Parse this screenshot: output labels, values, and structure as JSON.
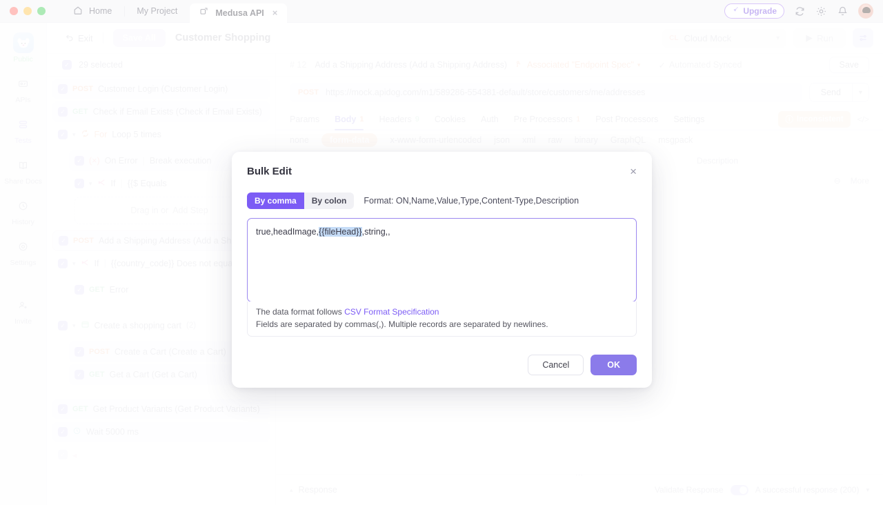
{
  "titlebar": {
    "tabs": [
      {
        "label": "Home",
        "icon": "home-icon",
        "active": false
      },
      {
        "label": "My Project",
        "icon": "",
        "active": false
      },
      {
        "label": "Medusa API",
        "icon": "external-link-icon",
        "active": true,
        "close": "×"
      }
    ],
    "upgrade_label": "Upgrade",
    "icons": [
      "rocket-icon",
      "refresh-icon",
      "gear-icon",
      "bell-icon",
      "avatar"
    ]
  },
  "rail": {
    "items": [
      {
        "label": "Public",
        "icon": "project-avatar-icon"
      },
      {
        "label": "APIs",
        "icon": "apis-icon"
      },
      {
        "label": "Tests",
        "icon": "tests-icon"
      },
      {
        "label": "Share Docs",
        "icon": "share-docs-icon"
      },
      {
        "label": "History",
        "icon": "history-icon"
      },
      {
        "label": "Settings",
        "icon": "settings-icon"
      },
      {
        "label": "Invite",
        "icon": "invite-icon"
      }
    ]
  },
  "toolbar": {
    "exit_label": "Exit",
    "save_all_label": "Save All",
    "doc_title": "Customer Shopping",
    "env_badge": "CL",
    "env_label": "Cloud Mock",
    "run_label": "Run"
  },
  "list_panel": {
    "selected_label": "29 selected",
    "drop_hint_prefix": "Drag in or",
    "drop_hint_action": "Add Step",
    "rows": [
      {
        "method": "POST",
        "label": "Customer Login (Customer Login)",
        "indent": 0,
        "type": "request"
      },
      {
        "method": "GET",
        "label": "Check if Email Exists (Check if Email Exists)",
        "indent": 0,
        "type": "request"
      },
      {
        "method": "",
        "kind": "For",
        "label": "Loop 5 times",
        "indent": 0,
        "type": "loop",
        "icon": "loop-icon"
      },
      {
        "method": "",
        "kind": "On Error",
        "label": "Break execution",
        "indent": 1,
        "type": "onerror",
        "icon": "error-icon"
      },
      {
        "method": "",
        "kind": "If",
        "label": "{{$  Equals",
        "indent": 1,
        "type": "if",
        "icon": "branch-icon"
      },
      {
        "method": "POST",
        "label": "Add a Shipping Address (Add a Shippi",
        "indent": 0,
        "type": "request",
        "selected": true
      },
      {
        "method": "",
        "kind": "If",
        "label": "{{country_code}}  Does not equa",
        "indent": 0,
        "type": "if",
        "icon": "branch-icon"
      },
      {
        "method": "GET",
        "label": "Error",
        "indent": 1,
        "type": "request"
      },
      {
        "method": "",
        "kind": "",
        "label": "Create a shopping cart",
        "count": "(2)",
        "indent": 0,
        "type": "folder",
        "icon": "folder-icon"
      },
      {
        "method": "POST",
        "label": "Create a Cart (Create a Cart)",
        "indent": 1,
        "type": "request"
      },
      {
        "method": "GET",
        "label": "Get a Cart (Get a Cart)",
        "indent": 1,
        "type": "request"
      },
      {
        "method": "GET",
        "label": "Get Product Variants (Get Product Variants)",
        "indent": 0,
        "type": "request"
      },
      {
        "method": "",
        "kind": "",
        "label": "Wait 5000 ms",
        "indent": 0,
        "type": "wait",
        "icon": "clock-icon"
      }
    ]
  },
  "main": {
    "header": {
      "number": "# 12",
      "title": "Add a Shipping Address (Add a Shipping Address)",
      "associated": "Associated \"Endpoint Spec\"",
      "sync_status": "Automated Synced",
      "save_label": "Save"
    },
    "url": {
      "method": "POST",
      "value": "https://mock.apidog.com/m1/589286-554381-default/store/customers/me/addresses",
      "send_label": "Send"
    },
    "tabs": [
      {
        "label": "Params",
        "badge": "",
        "active": false
      },
      {
        "label": "Body",
        "badge": "1",
        "badge_color": "orange",
        "active": true
      },
      {
        "label": "Headers",
        "badge": "9",
        "badge_color": "green",
        "active": false
      },
      {
        "label": "Cookies",
        "badge": "",
        "active": false
      },
      {
        "label": "Auth",
        "badge": "",
        "active": false
      },
      {
        "label": "Pre Processors",
        "badge": "1",
        "badge_color": "orange",
        "active": false
      },
      {
        "label": "Post Processors",
        "badge": "",
        "active": false
      },
      {
        "label": "Settings",
        "badge": "",
        "active": false
      }
    ],
    "inconsistent_label": "Inconsistent",
    "body_types": [
      {
        "label": "none",
        "active": false
      },
      {
        "label": "form-data",
        "active": true
      },
      {
        "label": "x-www-form-urlencoded",
        "active": false
      },
      {
        "label": "json",
        "active": false
      },
      {
        "label": "xml",
        "active": false
      },
      {
        "label": "raw",
        "active": false
      },
      {
        "label": "binary",
        "active": false
      },
      {
        "label": "GraphQL",
        "active": false
      },
      {
        "label": "msgpack",
        "active": false
      }
    ],
    "table": {
      "desc_header": "Description",
      "more_label": "More"
    },
    "response": {
      "label": "Response",
      "validate_label": "Validate Response",
      "status_label": "A successful response (200)"
    }
  },
  "modal": {
    "title": "Bulk Edit",
    "close": "×",
    "segments": [
      {
        "label": "By comma",
        "active": true
      },
      {
        "label": "By colon",
        "active": false
      }
    ],
    "format_label": "Format: ON,Name,Value,Type,Content-Type,Description",
    "editor": {
      "text_before": "true,headImage,",
      "text_highlight": "{{fileHead}}",
      "text_after": ",string,,",
      "full_value": "true,headImage,{{fileHead}},string,,"
    },
    "hint_line1_prefix": "The data format follows",
    "hint_line1_link": "CSV Format Specification",
    "hint_line2": "Fields are separated by commas(,). Multiple records are separated by newlines.",
    "cancel_label": "Cancel",
    "ok_label": "OK"
  },
  "colors": {
    "accent_purple": "#7c5cf5",
    "ok_button": "#8b7bea",
    "post_orange": "#f0a07a",
    "get_green": "#8fd3a8",
    "highlight_blue": "#c5dcf7"
  }
}
